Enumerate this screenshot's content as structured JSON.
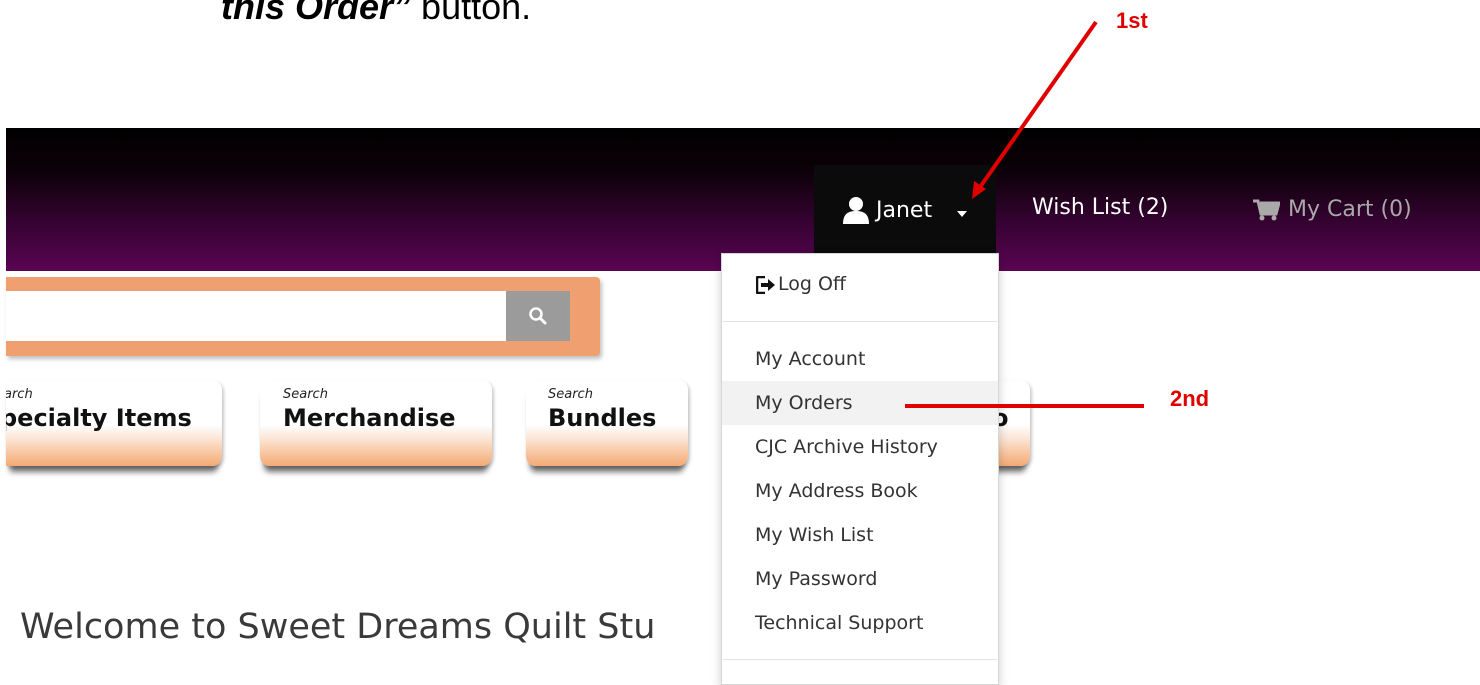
{
  "instruction": {
    "emphasis": "this Order”",
    "rest": " button."
  },
  "annotations": {
    "first": "1st",
    "second": "2nd",
    "color": "#e00000"
  },
  "header": {
    "user_name": "Janet",
    "user_icon": "user-icon",
    "wish_list_label": "Wish List (2)",
    "cart_icon": "cart-icon",
    "cart_label": "My Cart (0)",
    "colors": {
      "top": "#000000",
      "bottom": "#5a0553"
    }
  },
  "search": {
    "placeholder": "",
    "button_icon": "search-icon",
    "accent": "#f0a070"
  },
  "tiles": [
    {
      "small": "arch",
      "big": "pecialty Items"
    },
    {
      "small": "Search",
      "big": "Merchandise"
    },
    {
      "small": "Search",
      "big": "Bundles"
    },
    {
      "small": "",
      "big": "o"
    }
  ],
  "welcome": "Welcome to Sweet Dreams Quilt Stu",
  "user_menu": {
    "logoff": {
      "label": "Log Off",
      "icon": "log-off-icon"
    },
    "items": [
      "My Account",
      "My Orders",
      "CJC Archive History",
      "My Address Book",
      "My Wish List",
      "My Password",
      "Technical Support"
    ],
    "active_index": 1
  }
}
